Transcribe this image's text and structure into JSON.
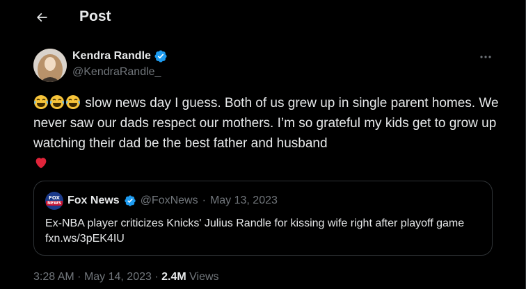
{
  "header": {
    "title": "Post",
    "back_icon": "arrow-left-icon"
  },
  "author": {
    "name": "Kendra Randle",
    "handle": "@KendraRandle_",
    "verified": true,
    "verified_color": "#1d9bf0"
  },
  "tweet": {
    "emojis": [
      "😂",
      "😂",
      "😂"
    ],
    "text": "slow news day I guess. Both of us grew up in single parent homes. We never saw our dads respect our mothers. I’m so grateful my kids get to grow up watching their dad be the best father and husband",
    "trailing_emoji": "❤️"
  },
  "quote": {
    "logo_line1": "FOX",
    "logo_line2": "NEWS",
    "name": "Fox News",
    "handle": "@FoxNews",
    "separator": "·",
    "date": "May 13, 2023",
    "text": "Ex-NBA player criticizes Knicks' Julius Randle for kissing wife right after playoff game fxn.ws/3pEK4IU"
  },
  "meta": {
    "time": "3:28 AM",
    "separator": "·",
    "date": "May 14, 2023",
    "views_count": "2.4M",
    "views_label": "Views"
  },
  "colors": {
    "background": "#000000",
    "text_primary": "#e7e9ea",
    "text_secondary": "#71767b",
    "border": "#2f3336",
    "verified_blue": "#1d9bf0",
    "heart_red": "#f91880"
  }
}
